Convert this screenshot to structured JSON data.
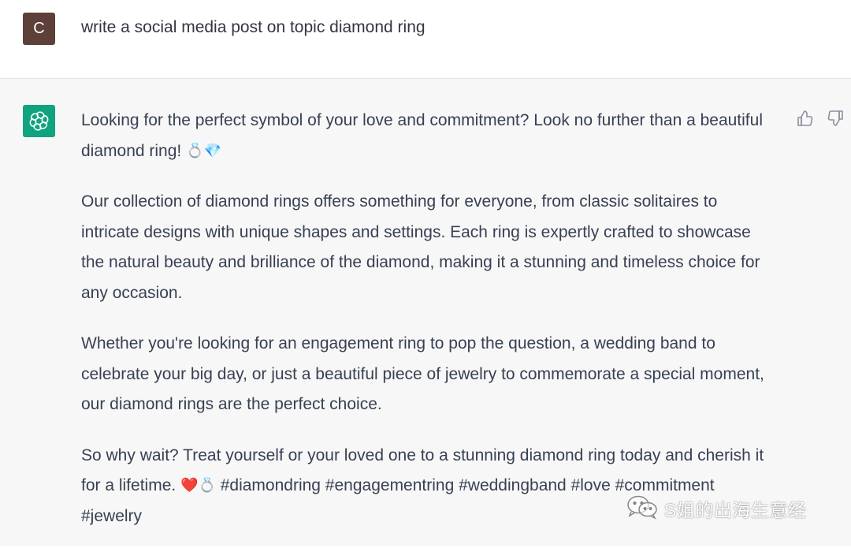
{
  "user_message": {
    "avatar_letter": "C",
    "text": "write a social media post on topic diamond ring"
  },
  "assistant_message": {
    "avatar_icon": "openai-logo-icon",
    "paragraphs": [
      {
        "text": "Looking for the perfect symbol of your love and commitment? Look no further than a beautiful diamond ring! ",
        "emoji_1": "💍",
        "emoji_2": "💎",
        "tail": ""
      },
      {
        "text": "Our collection of diamond rings offers something for everyone, from classic solitaires to intricate designs with unique shapes and settings. Each ring is expertly crafted to showcase the natural beauty and brilliance of the diamond, making it a stunning and timeless choice for any occasion."
      },
      {
        "text": "Whether you're looking for an engagement ring to pop the question, a wedding band to celebrate your big day, or just a beautiful piece of jewelry to commemorate a special moment, our diamond rings are the perfect choice."
      },
      {
        "text": "So why wait? Treat yourself or your loved one to a stunning diamond ring today and cherish it for a lifetime. ",
        "emoji_1": "❤️",
        "emoji_2": "💍",
        "tail": " #diamondring #engagementring #weddingband #love #commitment #jewelry"
      }
    ],
    "feedback_icons": [
      "thumbs-up-icon",
      "thumbs-down-icon"
    ]
  },
  "watermark": {
    "icon": "wechat-icon",
    "text": "S姐的出海生意经"
  },
  "colors": {
    "user_avatar_bg": "#5d4037",
    "assistant_avatar_bg": "#10a37f",
    "assistant_row_bg": "#f7f7f8",
    "text": "#374151"
  }
}
